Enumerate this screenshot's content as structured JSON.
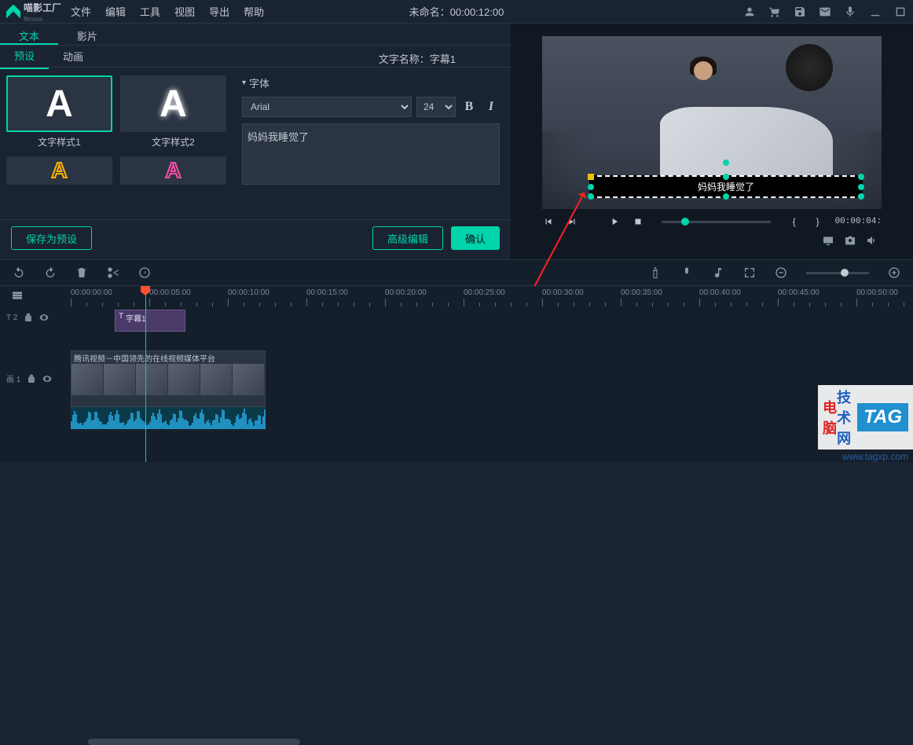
{
  "app": {
    "name": "喵影工厂",
    "sub": "filmora"
  },
  "menu": [
    "文件",
    "编辑",
    "工具",
    "视图",
    "导出",
    "帮助"
  ],
  "title": "未命名：00:00:12:00",
  "tabs1": {
    "text": "文本",
    "video": "影片"
  },
  "tabs2": {
    "preset": "预设",
    "anim": "动画"
  },
  "textNameLabel": "文字名称：",
  "textNameValue": "字幕1",
  "styles": [
    {
      "label": "文字样式1",
      "variant": "plain"
    },
    {
      "label": "文字样式2",
      "variant": "glow"
    }
  ],
  "fontHeader": "字体",
  "font": {
    "family": "Arial",
    "size": "24"
  },
  "subtitleText": "妈妈我睡觉了",
  "previewSubtitle": "妈妈我睡觉了",
  "buttons": {
    "savePreset": "保存为预设",
    "advanced": "高级编辑",
    "confirm": "确认"
  },
  "playback": {
    "time": "00:00:04:"
  },
  "ruler": [
    "00:00:00:00",
    "00:00:05:00",
    "00:00:10:00",
    "00:00:15:00",
    "00:00:20:00",
    "00:00:25:00",
    "00:00:30:00",
    "00:00:35:00",
    "00:00:40:00",
    "00:00:45:00",
    "00:00:50:00"
  ],
  "tracks": {
    "t_text": "T 2",
    "t_video": "画 1"
  },
  "clipSubtitle": "字幕1",
  "clipVideoTitle": "腾讯视频－中国领先的在线视频媒体平台",
  "watermark": {
    "a": "电脑",
    "b": "技术网",
    "tag": "TAG",
    "url": "www.tagxp.com"
  }
}
